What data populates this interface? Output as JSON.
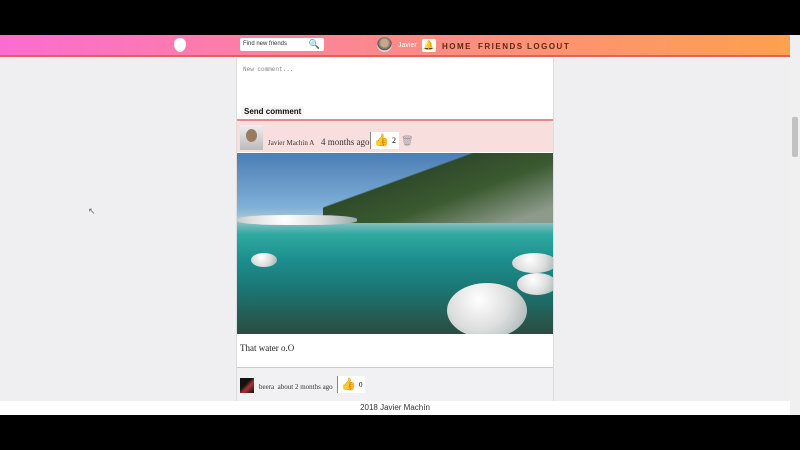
{
  "header": {
    "search_placeholder": "Find new friends",
    "user_name": "Javier",
    "nav": [
      "HOME",
      "FRIENDS",
      "LOGOUT"
    ]
  },
  "comment_form": {
    "placeholder": "New comment...",
    "send_label": "Send comment"
  },
  "posts": [
    {
      "author": "Javier Machín A",
      "time": "4 months ago",
      "likes": "2",
      "caption": "That water o.O"
    },
    {
      "author": "beera",
      "time": "about 2 months ago",
      "likes": "0"
    }
  ],
  "footer": {
    "text": "2018 Javier Machín"
  }
}
